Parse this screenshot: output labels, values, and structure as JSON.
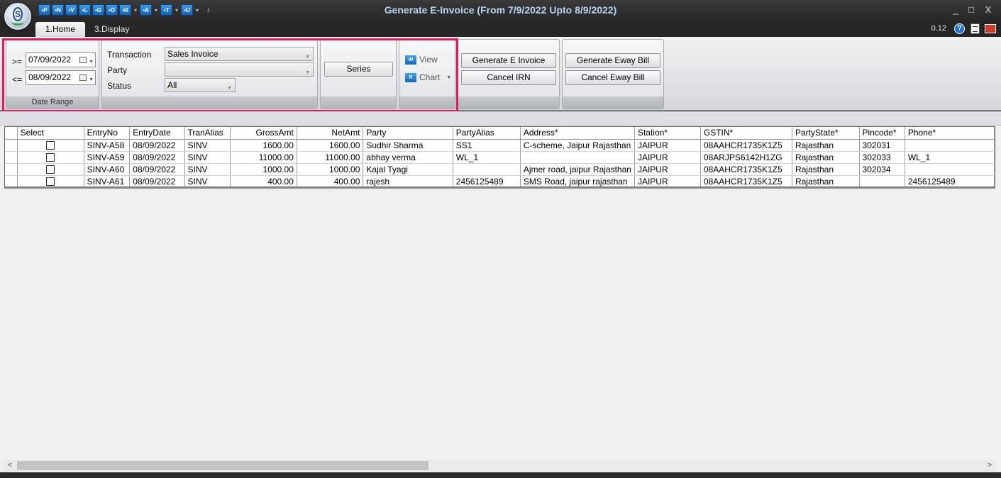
{
  "window": {
    "title": "Generate E-Invoice (From 7/9/2022 Upto 8/9/2022)",
    "min": "_",
    "max": "□",
    "close": "X"
  },
  "qat": [
    "P",
    "N",
    "V",
    "L",
    "G",
    "O",
    "R",
    "A",
    "T",
    "U"
  ],
  "tabs": [
    {
      "label": "1.Home"
    },
    {
      "label": "3.Display"
    }
  ],
  "version": "0.12",
  "help_glyph": "?",
  "date_range": {
    "ge_label": ">=",
    "le_label": "<=",
    "from": "07/09/2022",
    "to": "08/09/2022",
    "group_label": "Date Range"
  },
  "filters": {
    "transaction_label": "Transaction",
    "transaction_value": "Sales Invoice",
    "party_label": "Party",
    "party_value": "",
    "status_label": "Status",
    "status_value": "All"
  },
  "series_label": "Series",
  "view_label": "View",
  "chart_label": "Chart",
  "einvoice": {
    "generate": "Generate E Invoice",
    "cancel": "Cancel IRN"
  },
  "eway": {
    "generate": "Generate Eway Bill",
    "cancel": "Cancel Eway Bill"
  },
  "grid": {
    "columns": [
      "",
      "Select",
      "EntryNo",
      "EntryDate",
      "TranAlias",
      "GrossAmt",
      "NetAmt",
      "Party",
      "PartyAlias",
      "Address*",
      "Station*",
      "GSTIN*",
      "PartyState*",
      "Pincode*",
      "Phone*"
    ],
    "rows": [
      [
        "",
        "",
        "SINV-A58",
        "08/09/2022",
        "SINV",
        "1600.00",
        "1600.00",
        "Sudhir Sharma",
        "SS1",
        "C-scheme, Jaipur Rajasthan",
        "JAIPUR",
        "08AAHCR1735K1Z5",
        "Rajasthan",
        " 302031",
        ""
      ],
      [
        "",
        "",
        "SINV-A59",
        "08/09/2022",
        "SINV",
        "11000.00",
        "11000.00",
        "abhay verma",
        "WL_1",
        "",
        "JAIPUR",
        "08ARJPS6142H1ZG",
        "Rajasthan",
        "302033",
        "WL_1"
      ],
      [
        "",
        "",
        "SINV-A60",
        "08/09/2022",
        "SINV",
        "1000.00",
        "1000.00",
        "Kajal Tyagi",
        "",
        "Ajmer road, jaipur Rajasthan",
        "JAIPUR",
        "08AAHCR1735K1Z5",
        "Rajasthan",
        "302034",
        ""
      ],
      [
        "",
        "",
        "SINV-A61",
        "08/09/2022",
        "SINV",
        "400.00",
        "400.00",
        "rajesh",
        "2456125489",
        "SMS Road, jaipur rajasthan",
        "JAIPUR",
        "08AAHCR1735K1Z5",
        "Rajasthan",
        "",
        "2456125489"
      ]
    ]
  }
}
